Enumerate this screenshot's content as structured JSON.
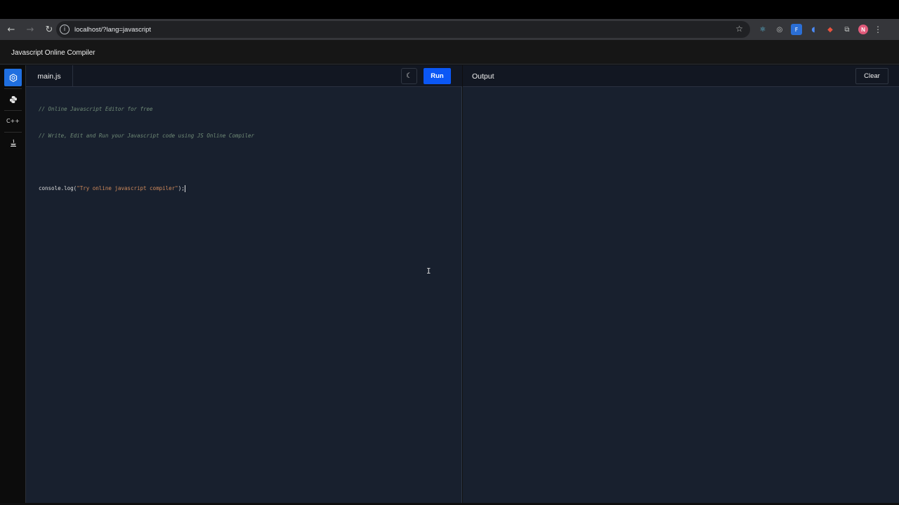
{
  "browser": {
    "url": "localhost/?lang=javascript",
    "back_icon": "arrow-left-icon",
    "forward_icon": "arrow-right-icon",
    "reload_icon": "reload-icon",
    "avatar_letter": "N"
  },
  "app": {
    "title": "Javascript Online Compiler"
  },
  "sidebar": {
    "items": [
      {
        "name": "javascript",
        "icon": "javascript-icon",
        "active": true
      },
      {
        "name": "python",
        "icon": "python-icon",
        "active": false
      },
      {
        "name": "cpp",
        "icon": "cpp-icon",
        "glyph": "C++",
        "active": false
      },
      {
        "name": "java",
        "icon": "java-icon",
        "active": false
      }
    ]
  },
  "editor": {
    "file_name": "main.js",
    "run_label": "Run",
    "theme_icon": "moon-icon",
    "code": {
      "comment1": "// Online Javascript Editor for free",
      "comment2": "// Write, Edit and Run your Javascript code using JS Online Compiler",
      "call_prefix": "console.log(",
      "string": "\"Try online javascript compiler\"",
      "call_suffix": ");"
    }
  },
  "output": {
    "title": "Output",
    "clear_label": "Clear"
  },
  "colors": {
    "accent": "#0b57f5",
    "editor_bg": "#18202e",
    "comment": "#6f8a76",
    "string": "#d08a5b"
  }
}
